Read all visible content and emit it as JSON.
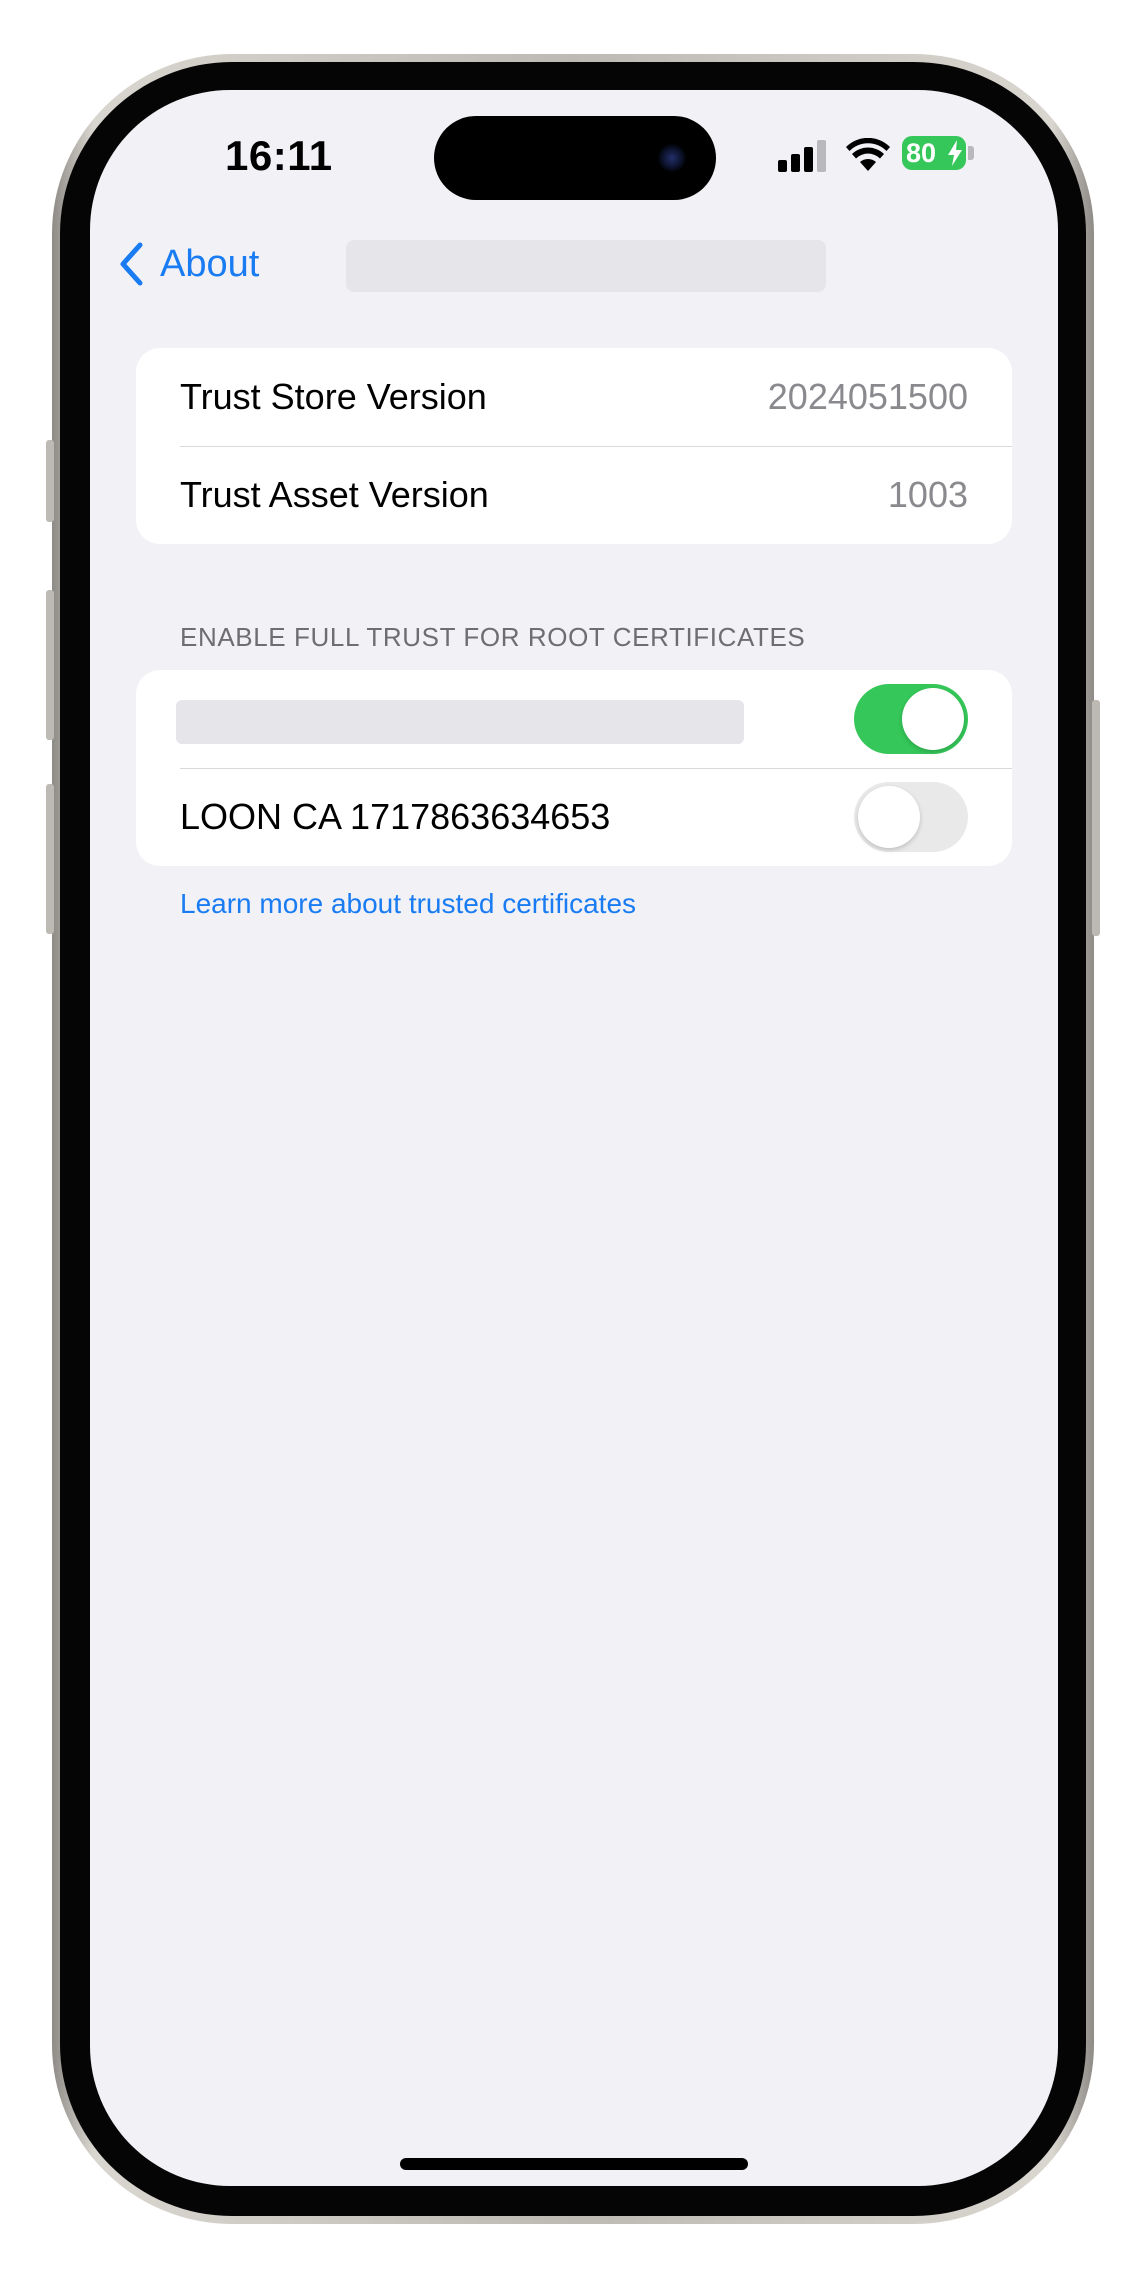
{
  "status_bar": {
    "time": "16:11",
    "battery_level": "80",
    "battery_color": "#35c759"
  },
  "nav": {
    "back_label": "About",
    "accent_color": "#1a7cf2"
  },
  "versions": {
    "rows": [
      {
        "label": "Trust Store Version",
        "value": "2024051500"
      },
      {
        "label": "Trust Asset Version",
        "value": "1003"
      }
    ]
  },
  "trust_section": {
    "header": "ENABLE FULL TRUST FOR ROOT CERTIFICATES",
    "certificates": [
      {
        "name": "",
        "redacted": true,
        "enabled": true
      },
      {
        "name": "LOON CA 1717863634653",
        "redacted": false,
        "enabled": false
      }
    ],
    "learn_more": "Learn more about trusted certificates"
  }
}
